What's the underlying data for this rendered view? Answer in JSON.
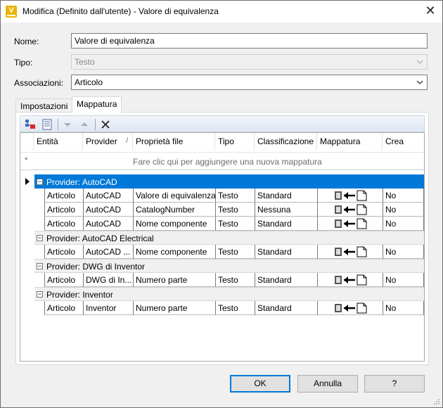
{
  "window": {
    "title": "Modifica (Definito dall'utente) - Valore di equivalenza",
    "icon_glyph": "V",
    "close_glyph": "✕"
  },
  "form": {
    "name_label": "Nome:",
    "name_value": "Valore di equivalenza",
    "type_label": "Tipo:",
    "type_value": "Testo",
    "assoc_label": "Associazioni:",
    "assoc_value": "Articolo"
  },
  "tabs": [
    {
      "label": "Impostazioni",
      "active": false
    },
    {
      "label": "Mappatura",
      "active": true
    }
  ],
  "toolbar": {
    "icons": [
      "new-mapping-icon",
      "properties-icon",
      "move-down-icon",
      "move-up-icon",
      "delete-icon"
    ]
  },
  "grid": {
    "columns": [
      "Entità",
      "Provider",
      "Proprietà file",
      "Tipo",
      "Classificazione",
      "Mappatura",
      "Crea"
    ],
    "sort_glyph": "/",
    "new_row_marker": "*",
    "new_row_text": "Fare clic qui per aggiungere una nuova mappatura",
    "groups": [
      {
        "label": "Provider: AutoCAD",
        "selected": true,
        "rows": [
          [
            "Articolo",
            "AutoCAD",
            "Valore di equivalenza",
            "Testo",
            "Standard",
            "No"
          ],
          [
            "Articolo",
            "AutoCAD",
            "CatalogNumber",
            "Testo",
            "Nessuna",
            "No"
          ],
          [
            "Articolo",
            "AutoCAD",
            "Nome componente",
            "Testo",
            "Standard",
            "No"
          ]
        ]
      },
      {
        "label": "Provider: AutoCAD Electrical",
        "selected": false,
        "rows": [
          [
            "Articolo",
            "AutoCAD ...",
            "Nome componente",
            "Testo",
            "Standard",
            "No"
          ]
        ]
      },
      {
        "label": "Provider: DWG di Inventor",
        "selected": false,
        "rows": [
          [
            "Articolo",
            "DWG di In...",
            "Numero parte",
            "Testo",
            "Standard",
            "No"
          ]
        ]
      },
      {
        "label": "Provider: Inventor",
        "selected": false,
        "rows": [
          [
            "Articolo",
            "Inventor",
            "Numero parte",
            "Testo",
            "Standard",
            "No"
          ]
        ]
      }
    ]
  },
  "buttons": {
    "ok": "OK",
    "cancel": "Annulla",
    "help": "?"
  },
  "colors": {
    "selection": "#0078d7",
    "app_icon": "#e8b400"
  }
}
